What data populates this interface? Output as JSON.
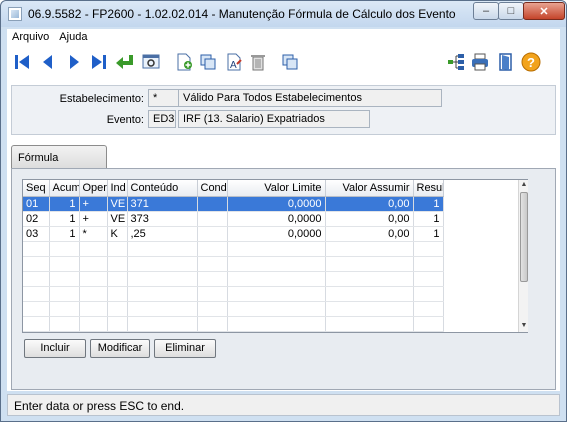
{
  "window": {
    "title": "06.9.5582 - FP2600 - 1.02.02.014 - Manutenção Fórmula de Cálculo dos Evento",
    "min_glyph": "–",
    "max_glyph": "□",
    "close_glyph": "✕"
  },
  "menu": {
    "arquivo": "Arquivo",
    "ajuda": "Ajuda"
  },
  "form": {
    "estabelecimento_label": "Estabelecimento:",
    "estabelecimento_code": "*",
    "estabelecimento_desc": "Válido Para Todos Estabelecimentos",
    "evento_label": "Evento:",
    "evento_code": "ED3",
    "evento_desc": "IRF (13. Salario) Expatriados"
  },
  "tab": {
    "label": "Fórmula"
  },
  "grid": {
    "columns": [
      "Seq",
      "Acum",
      "Oper",
      "Ind",
      "Conteúdo",
      "Cond",
      "Valor Limite",
      "Valor Assumir",
      "Resul"
    ],
    "rows": [
      {
        "seq": "01",
        "acum": "1",
        "oper": "+",
        "ind": "VE",
        "conteudo": "371",
        "cond": "",
        "valor_limite": "0,0000",
        "valor_assumir": "0,00",
        "resul": "1"
      },
      {
        "seq": "02",
        "acum": "1",
        "oper": "+",
        "ind": "VE",
        "conteudo": "373",
        "cond": "",
        "valor_limite": "0,0000",
        "valor_assumir": "0,00",
        "resul": "1"
      },
      {
        "seq": "03",
        "acum": "1",
        "oper": "*",
        "ind": "K",
        "conteudo": ",25",
        "cond": "",
        "valor_limite": "0,0000",
        "valor_assumir": "0,00",
        "resul": "1"
      }
    ],
    "selected_row": 0
  },
  "buttons": {
    "incluir": "Incluir",
    "modificar": "Modificar",
    "eliminar": "Eliminar"
  },
  "status": {
    "text": "Enter data or press ESC to end."
  },
  "colors": {
    "selection": "#3a79d8",
    "nav_blue": "#1f5fc8",
    "frame": "#cfe0f1"
  }
}
